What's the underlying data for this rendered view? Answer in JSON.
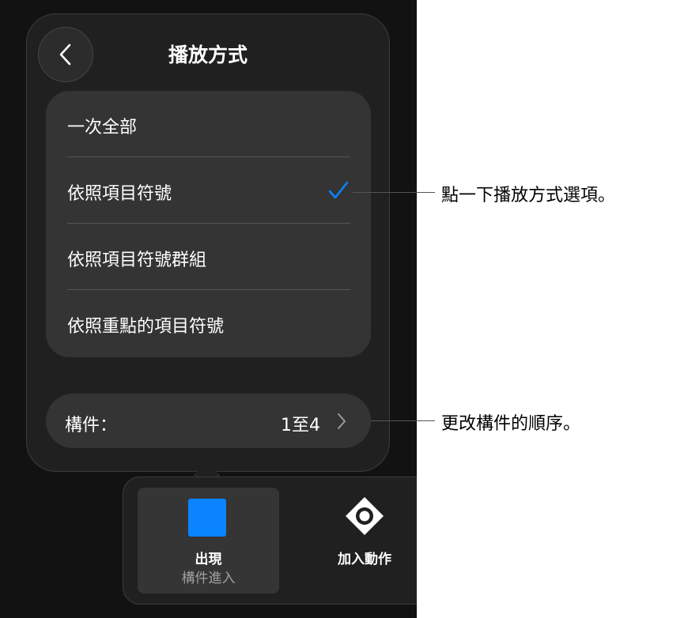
{
  "popover": {
    "title": "播放方式",
    "options": [
      {
        "label": "一次全部",
        "selected": false
      },
      {
        "label": "依照項目符號",
        "selected": true
      },
      {
        "label": "依照項目符號群組",
        "selected": false
      },
      {
        "label": "依照重點的項目符號",
        "selected": false
      }
    ],
    "parts": {
      "label": "構件：",
      "value": "1至4"
    }
  },
  "bottom_bar": {
    "appear": {
      "title": "出現",
      "subtitle": "構件進入"
    },
    "add_action": {
      "label": "加入動作"
    }
  },
  "callouts": [
    {
      "text": "點一下播放方式選項。"
    },
    {
      "text": "更改構件的順序。"
    }
  ],
  "colors": {
    "accent": "#0a84ff",
    "panel": "#202020",
    "row": "#343434"
  }
}
